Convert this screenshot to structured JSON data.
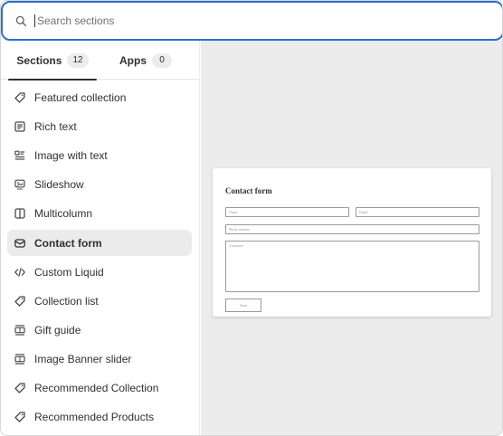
{
  "search": {
    "placeholder": "Search sections",
    "value": ""
  },
  "tabs": [
    {
      "label": "Sections",
      "count": "12"
    },
    {
      "label": "Apps",
      "count": "0"
    }
  ],
  "sections": [
    {
      "label": "Featured collection",
      "icon": "tag-icon"
    },
    {
      "label": "Rich text",
      "icon": "text-block-icon"
    },
    {
      "label": "Image with text",
      "icon": "image-with-text-icon"
    },
    {
      "label": "Slideshow",
      "icon": "slideshow-icon"
    },
    {
      "label": "Multicolumn",
      "icon": "columns-icon"
    },
    {
      "label": "Contact form",
      "icon": "email-icon",
      "selected": true
    },
    {
      "label": "Custom Liquid",
      "icon": "code-icon"
    },
    {
      "label": "Collection list",
      "icon": "tag-icon"
    },
    {
      "label": "Gift guide",
      "icon": "grid-block-icon"
    },
    {
      "label": "Image Banner slider",
      "icon": "grid-block-icon"
    },
    {
      "label": "Recommended Collection",
      "icon": "tag-icon"
    },
    {
      "label": "Recommended Products",
      "icon": "tag-icon"
    }
  ],
  "preview": {
    "title": "Contact form",
    "name_placeholder": "Name",
    "email_placeholder": "Email",
    "phone_placeholder": "Phone number",
    "comment_placeholder": "Comment",
    "button_label": "Send"
  }
}
